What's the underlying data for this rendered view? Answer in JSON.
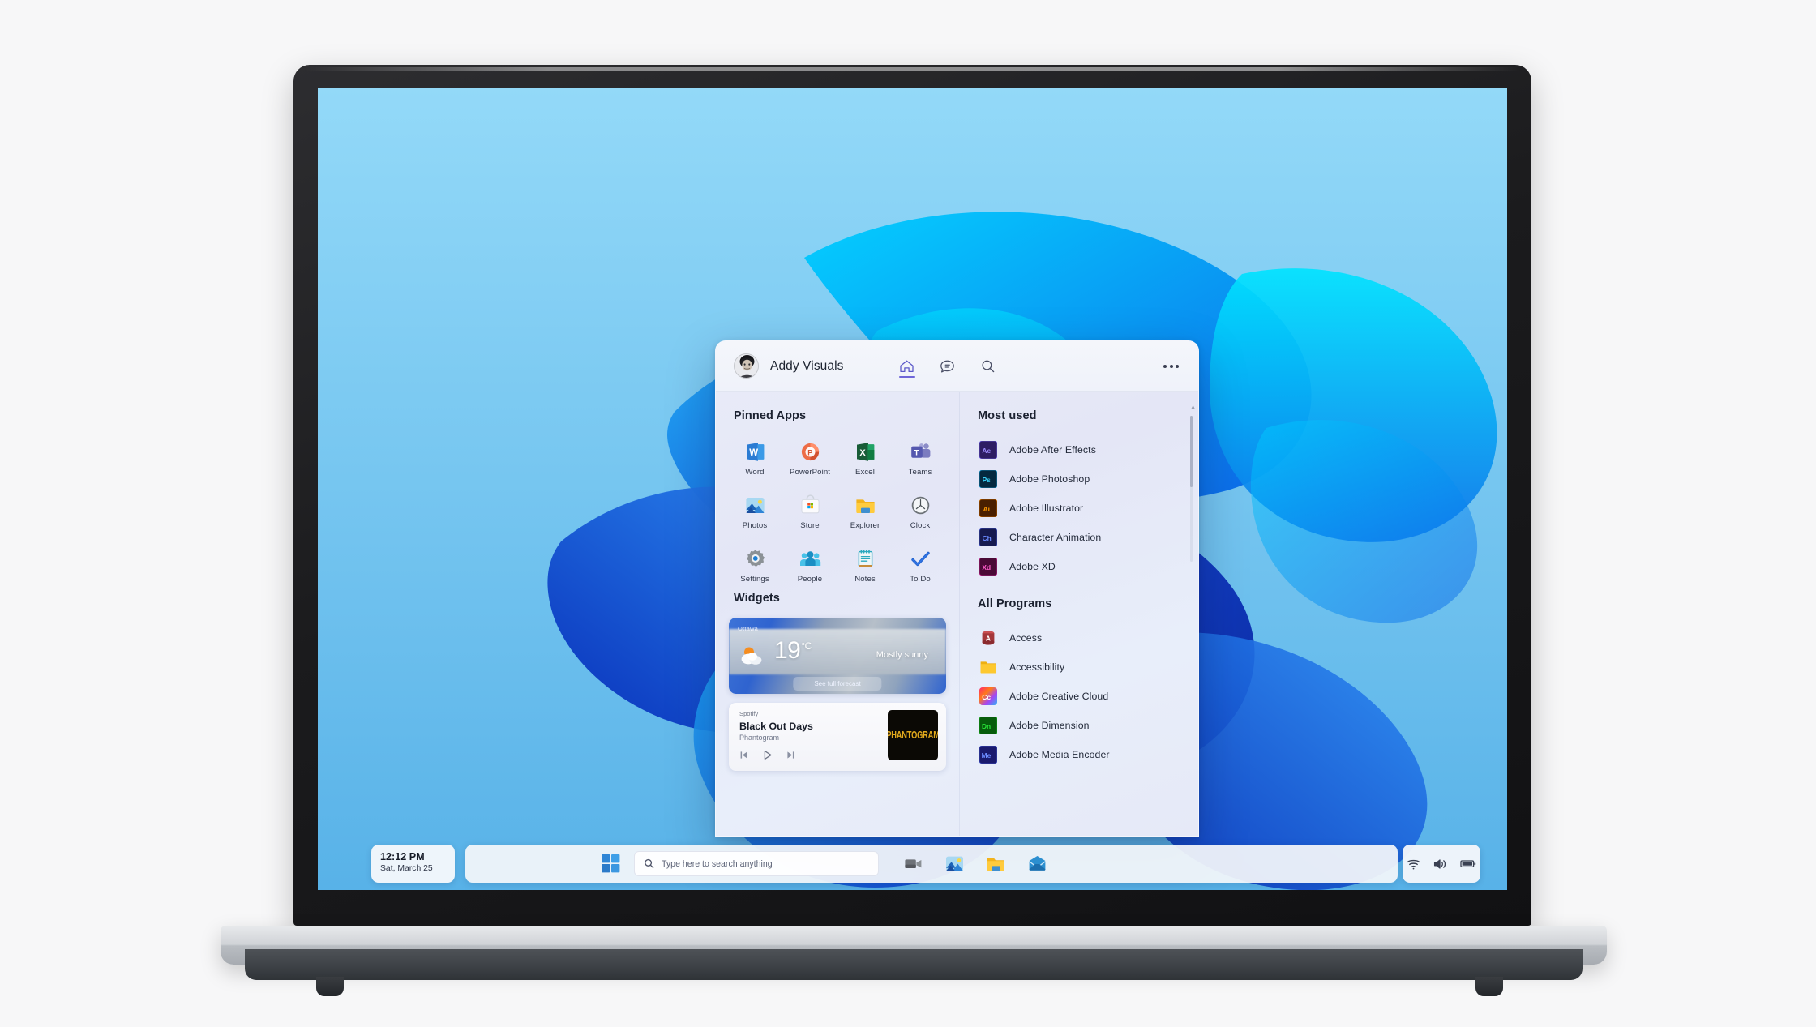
{
  "device": {
    "type": "laptop",
    "screen_content": "Windows 11 desktop with Start menu open"
  },
  "wallpaper": {
    "name": "Windows 11 Bloom",
    "background_color": "#7ecbf2",
    "ribbon_colors": [
      "#00b7ff",
      "#0a5de8",
      "#1a3fd8",
      "#3ba8f5",
      "#0b3fd0"
    ]
  },
  "start_menu": {
    "header": {
      "avatar": "user-avatar",
      "user_name": "Addy Visuals",
      "nav": [
        {
          "name": "home-icon",
          "label": "Home",
          "active": true
        },
        {
          "name": "chat-icon",
          "label": "Chat",
          "active": false
        },
        {
          "name": "search-icon",
          "label": "Search",
          "active": false
        }
      ],
      "more_label": "More options",
      "accent_color": "#6f66d8"
    },
    "pinned": {
      "title": "Pinned Apps",
      "apps": [
        {
          "label": "Word",
          "icon": "word-icon",
          "color": "#2b7cd3"
        },
        {
          "label": "PowerPoint",
          "icon": "powerpoint-icon",
          "color": "#d24726"
        },
        {
          "label": "Excel",
          "icon": "excel-icon",
          "color": "#1e7145"
        },
        {
          "label": "Teams",
          "icon": "teams-icon",
          "color": "#6264a7"
        },
        {
          "label": "Photos",
          "icon": "photos-icon",
          "color": "#2f7fd0"
        },
        {
          "label": "Store",
          "icon": "store-icon",
          "color": "#ffffff"
        },
        {
          "label": "Explorer",
          "icon": "explorer-icon",
          "color": "#f6b81c"
        },
        {
          "label": "Clock",
          "icon": "clock-icon",
          "color": "#6b7076"
        },
        {
          "label": "Settings",
          "icon": "settings-icon",
          "color": "#7b8288"
        },
        {
          "label": "People",
          "icon": "people-icon",
          "color": "#38b6e0"
        },
        {
          "label": "Notes",
          "icon": "notes-icon",
          "color": "#2aa9bf"
        },
        {
          "label": "To Do",
          "icon": "todo-icon",
          "color": "#2564cf"
        }
      ]
    },
    "widgets": {
      "title": "Widgets",
      "weather": {
        "location": "Ottawa",
        "temperature": "19",
        "unit": "°C",
        "condition": "Mostly sunny",
        "cta_label": "See full forecast",
        "icon": "sun-behind-cloud-icon"
      },
      "music": {
        "brand": "Spotify",
        "track_title": "Black Out Days",
        "artist": "Phantogram",
        "album_art_text": "PHANTOGRAM",
        "album_art_color": "#e0a81c",
        "controls": [
          {
            "name": "previous-track-button",
            "glyph": "prev"
          },
          {
            "name": "play-button",
            "glyph": "play"
          },
          {
            "name": "next-track-button",
            "glyph": "next"
          }
        ]
      }
    },
    "most_used": {
      "title": "Most used",
      "apps": [
        {
          "label": "Adobe After Effects",
          "badge": "Ae",
          "bg": "#2e1d63",
          "fg": "#9b8af8"
        },
        {
          "label": "Adobe Photoshop",
          "badge": "Ps",
          "bg": "#04293f",
          "fg": "#3ad3fa"
        },
        {
          "label": "Adobe Illustrator",
          "badge": "Ai",
          "bg": "#4a1f00",
          "fg": "#ff9a00"
        },
        {
          "label": "Character Animation",
          "badge": "Ch",
          "bg": "#161a4f",
          "fg": "#6b8bff"
        },
        {
          "label": "Adobe XD",
          "badge": "Xd",
          "bg": "#4a0a36",
          "fg": "#ff5ecb"
        }
      ]
    },
    "all_programs": {
      "title": "All Programs",
      "apps": [
        {
          "label": "Access",
          "icon": "access-icon",
          "badge": "A",
          "bg": "#a4373a",
          "fg": "#ffffff"
        },
        {
          "label": "Accessibility",
          "icon": "folder-icon",
          "badge": "",
          "bg": "#f6c416",
          "fg": "#ffffff"
        },
        {
          "label": "Adobe Creative Cloud",
          "icon": "creative-cloud-icon",
          "badge": "Cc",
          "bg": "#ef3d5c",
          "fg": "#ffffff"
        },
        {
          "label": "Adobe Dimension",
          "icon": "dimension-icon",
          "badge": "Dn",
          "bg": "#075c0c",
          "fg": "#29e53a"
        },
        {
          "label": "Adobe Media Encoder",
          "icon": "media-encoder-icon",
          "badge": "Me",
          "bg": "#1a1a6e",
          "fg": "#6b8bff"
        }
      ]
    },
    "scrollbar": {
      "name": "right-column-scrollbar",
      "position": "top"
    }
  },
  "taskbar": {
    "clock": {
      "time": "12:12 PM",
      "date": "Sat, March 25"
    },
    "start_button": {
      "name": "start-button",
      "label": "Start"
    },
    "search": {
      "placeholder": "Type here to search anything",
      "icon": "search-icon"
    },
    "pinned_apps": [
      {
        "label": "Teams",
        "icon": "teams-camera-icon",
        "color": "#6e7278"
      },
      {
        "label": "Photos",
        "icon": "photos-icon",
        "color": "#2f7fd0"
      },
      {
        "label": "File Explorer",
        "icon": "explorer-icon",
        "color": "#f6b81c"
      },
      {
        "label": "Mail",
        "icon": "mail-icon",
        "color": "#2b8fd0"
      }
    ],
    "tray": [
      {
        "label": "Network",
        "icon": "wifi-icon"
      },
      {
        "label": "Volume",
        "icon": "speaker-icon"
      },
      {
        "label": "Battery",
        "icon": "battery-icon"
      }
    ]
  }
}
